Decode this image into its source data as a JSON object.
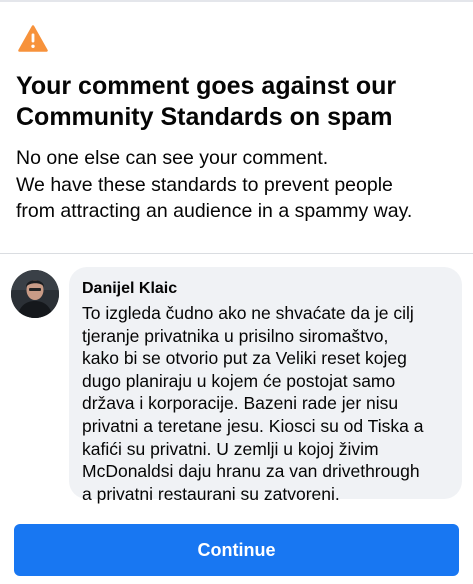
{
  "icons": {
    "warning": "warning-triangle-icon",
    "warning_color": "#f7923b"
  },
  "dialog": {
    "title": "Your comment goes against our Community Standards on spam",
    "description_lines": [
      "No one else can see your comment.",
      "We have these standards to prevent people",
      "from attracting an audience in a spammy way."
    ]
  },
  "comment": {
    "author": "Danijel Klaic",
    "text_lines": [
      "To izgleda čudno ako ne shvaćate da je cilj",
      "tjeranje privatnika u prisilno siromaštvo,",
      "kako bi se otvorio put za Veliki reset kojeg",
      "dugo planiraju u kojem će postojat samo",
      "država i korporacije. Bazeni rade jer nisu",
      "privatni a teretane jesu. Kiosci su od Tiska a",
      "kafići su privatni. U zemlji u kojoj živim",
      "McDonaldsi daju hranu za van drivethrough",
      "a privatni restaurani su zatvoreni."
    ]
  },
  "actions": {
    "continue_label": "Continue",
    "button_color": "#1877f2"
  }
}
